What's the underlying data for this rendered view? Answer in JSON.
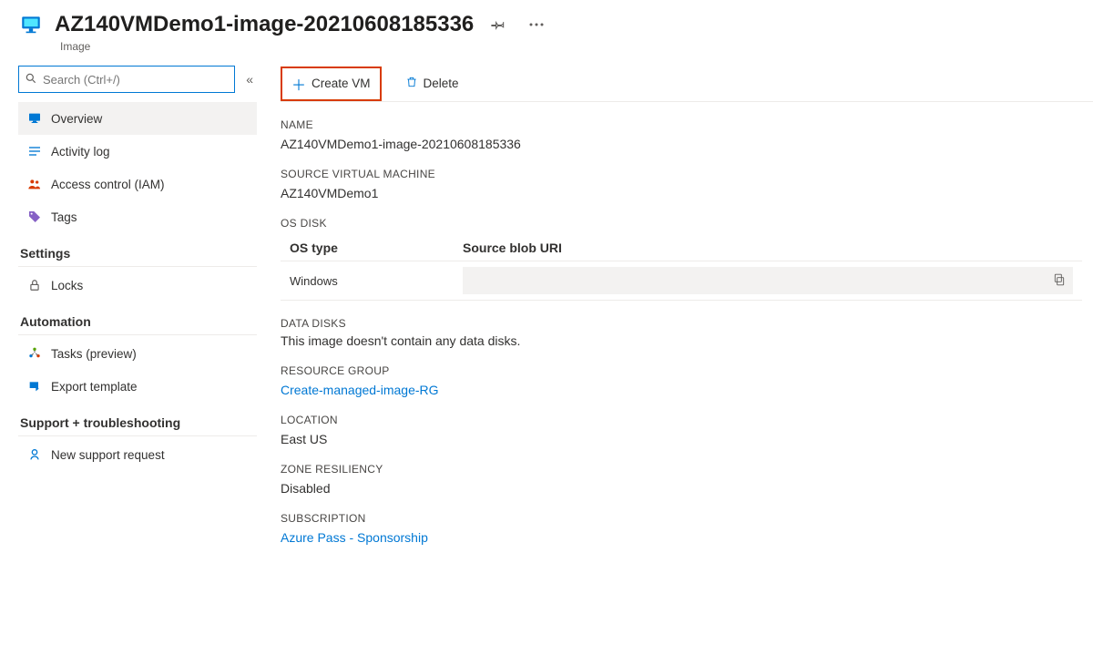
{
  "header": {
    "title": "AZ140VMDemo1-image-20210608185336",
    "subtype": "Image"
  },
  "search": {
    "placeholder": "Search (Ctrl+/)"
  },
  "sidebar": {
    "items": {
      "overview": "Overview",
      "activity_log": "Activity log",
      "access_control": "Access control (IAM)",
      "tags": "Tags"
    },
    "sections": {
      "settings": {
        "label": "Settings",
        "items": {
          "locks": "Locks"
        }
      },
      "automation": {
        "label": "Automation",
        "items": {
          "tasks": "Tasks (preview)",
          "export": "Export template"
        }
      },
      "support": {
        "label": "Support + troubleshooting",
        "items": {
          "new_request": "New support request"
        }
      }
    }
  },
  "toolbar": {
    "create_vm": "Create VM",
    "delete": "Delete"
  },
  "details": {
    "name_label": "NAME",
    "name_value": "AZ140VMDemo1-image-20210608185336",
    "source_vm_label": "SOURCE VIRTUAL MACHINE",
    "source_vm_value": "AZ140VMDemo1",
    "os_disk_label": "OS DISK",
    "os_disk_cols": {
      "os_type": "OS type",
      "source_blob": "Source blob URI"
    },
    "os_disk_row": {
      "os_type": "Windows",
      "source_blob": ""
    },
    "data_disks_label": "DATA DISKS",
    "data_disks_value": "This image doesn't contain any data disks.",
    "rg_label": "RESOURCE GROUP",
    "rg_value": "Create-managed-image-RG",
    "location_label": "LOCATION",
    "location_value": "East US",
    "zone_label": "ZONE RESILIENCY",
    "zone_value": "Disabled",
    "subscription_label": "SUBSCRIPTION",
    "subscription_value": "Azure Pass - Sponsorship"
  }
}
